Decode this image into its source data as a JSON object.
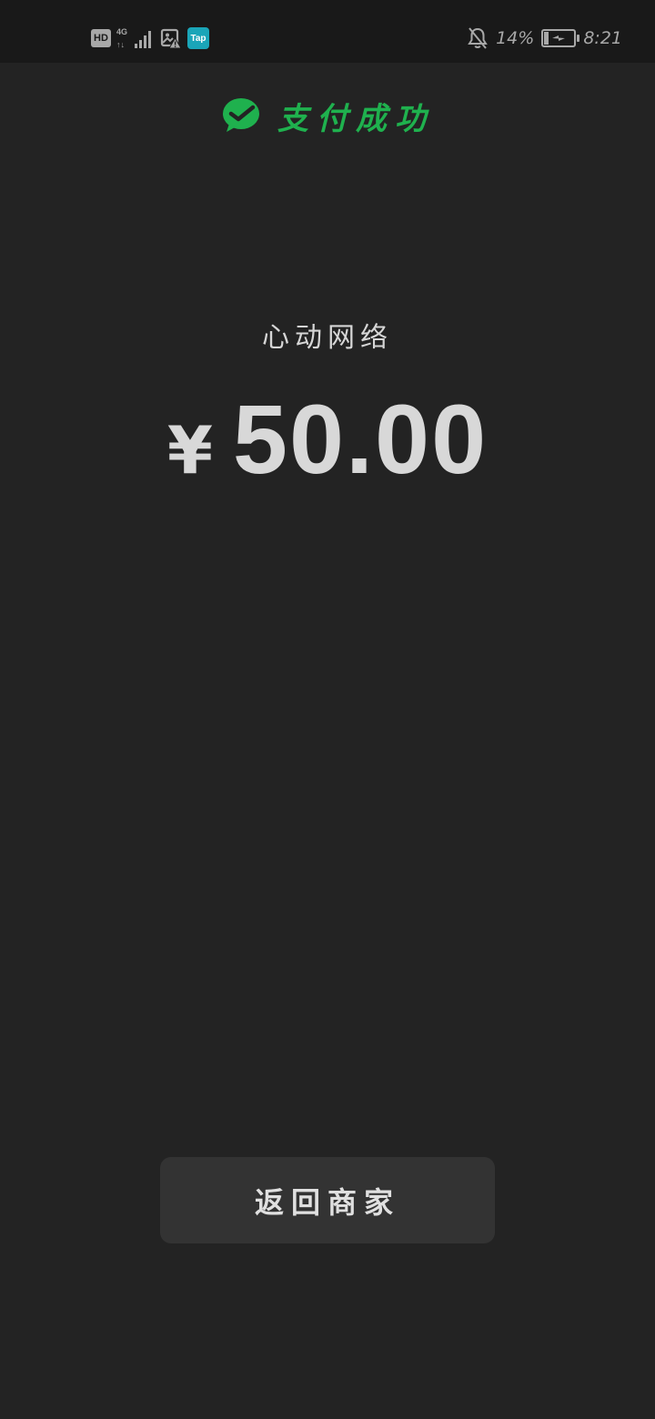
{
  "status_bar": {
    "hd_label": "HD",
    "network_label": "4G",
    "network_arrows": "↑↓",
    "tap_label": "Tap",
    "battery_percent_text": "14%",
    "battery_level": 0.14,
    "time": "8:21",
    "icons": [
      "signal-icon",
      "image-warning-icon",
      "bell-muted-icon",
      "battery-charging-icon"
    ]
  },
  "header": {
    "title": "支付成功",
    "icon": "wechat-pay-check-icon",
    "accent_color": "#1fb14e"
  },
  "payment": {
    "merchant": "心动网络",
    "currency_symbol": "¥",
    "amount": "50.00"
  },
  "actions": {
    "return_label": "返回商家"
  }
}
